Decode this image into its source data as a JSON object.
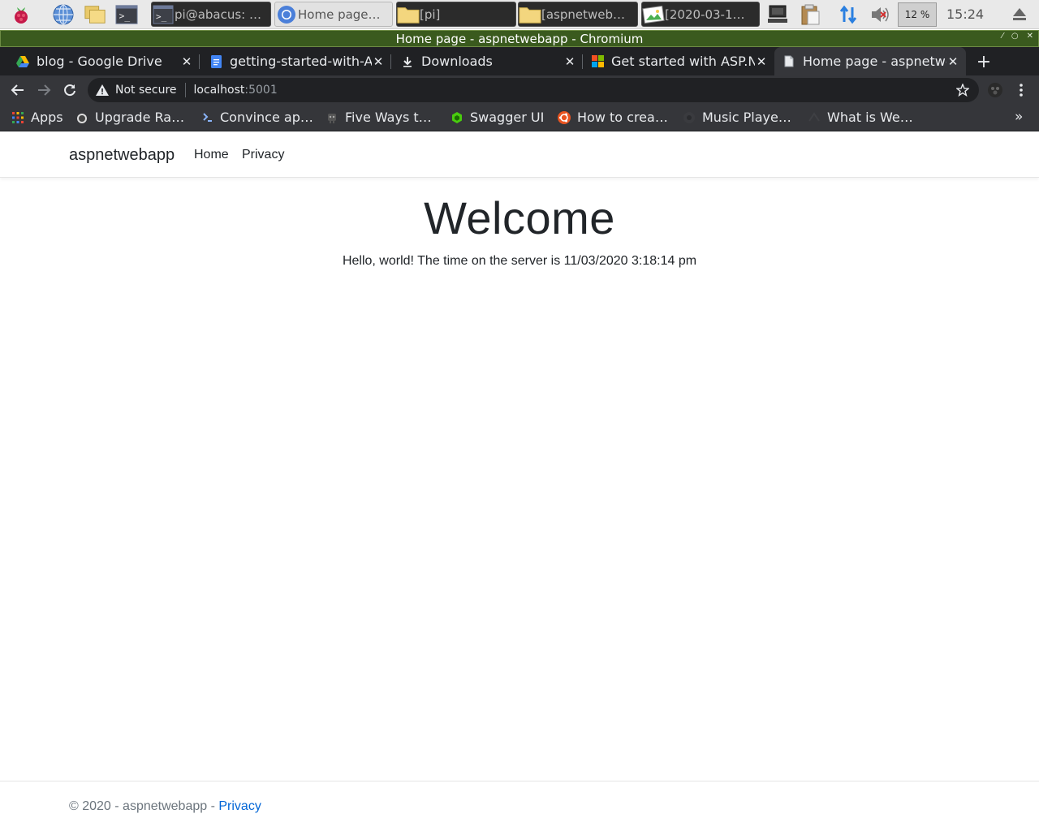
{
  "taskbar": {
    "tasks": [
      {
        "label": "pi@abacus: …",
        "icon": "terminal-icon"
      },
      {
        "label": "Home page…",
        "icon": "chromium-icon"
      },
      {
        "label": "[pi]",
        "icon": "folder-icon"
      },
      {
        "label": "[aspnetweb…",
        "icon": "folder-icon"
      },
      {
        "label": "[2020-03-1…",
        "icon": "image-viewer-icon"
      }
    ],
    "cpu_label": "12 %",
    "clock": "15:24"
  },
  "window": {
    "title": "Home page - aspnetwebapp - Chromium"
  },
  "tabs": [
    {
      "title": "blog - Google Drive",
      "icon": "google-drive-icon"
    },
    {
      "title": "getting-started-with-ASP",
      "icon": "google-docs-icon"
    },
    {
      "title": "Downloads",
      "icon": "download-icon"
    },
    {
      "title": "Get started with ASP.NET",
      "icon": "microsoft-icon"
    },
    {
      "title": "Home page - aspnetwebapp",
      "icon": "page-icon",
      "active": true
    }
  ],
  "omnibox": {
    "security": "Not secure",
    "host": "localhost",
    "port": ":5001"
  },
  "bookmarks": [
    {
      "label": "Apps",
      "icon": "apps-grid-icon"
    },
    {
      "label": "Upgrade Ra…",
      "icon": "raspberry-icon"
    },
    {
      "label": "Convince ap…",
      "icon": "bookmark-favicon-icon"
    },
    {
      "label": "Five Ways t…",
      "icon": "robot-icon"
    },
    {
      "label": "Swagger UI",
      "icon": "swagger-icon"
    },
    {
      "label": "How to crea…",
      "icon": "ubuntu-icon"
    },
    {
      "label": "Music Playe…",
      "icon": "music-icon"
    },
    {
      "label": "What is We…",
      "icon": "web-icon"
    }
  ],
  "site": {
    "brand": "aspnetwebapp",
    "nav": [
      "Home",
      "Privacy"
    ],
    "heading": "Welcome",
    "message": "Hello, world! The time on the server is 11/03/2020 3:18:14 pm",
    "footer_text": "© 2020 - aspnetwebapp - ",
    "footer_link": "Privacy"
  },
  "colors": {
    "titlebar": "#3a5a1e",
    "tabstrip": "#202124",
    "toolbar": "#35363a",
    "link": "#0366d6"
  }
}
